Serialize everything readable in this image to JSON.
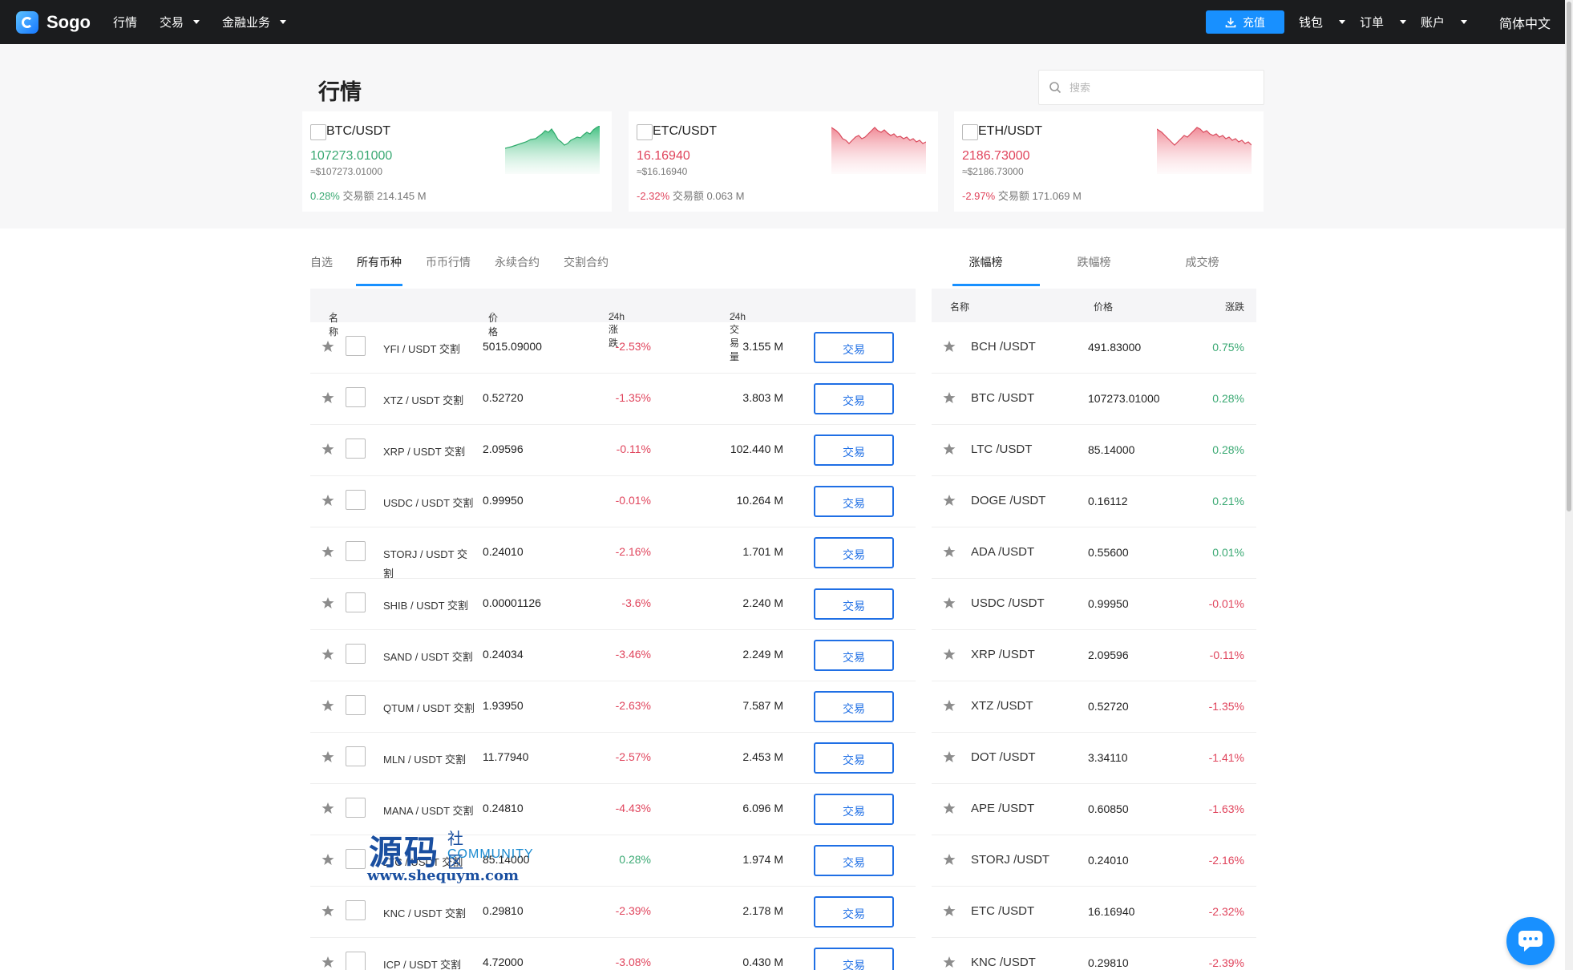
{
  "nav": {
    "logo_text": "Sogo",
    "items": [
      {
        "label": "行情",
        "caret": false
      },
      {
        "label": "交易",
        "caret": true
      },
      {
        "label": "金融业务",
        "caret": true
      }
    ],
    "recharge_label": "充值",
    "right_items": [
      {
        "label": "钱包"
      },
      {
        "label": "订单"
      },
      {
        "label": "账户"
      }
    ],
    "language": "简体中文"
  },
  "page": {
    "title": "行情",
    "search_placeholder": "搜索"
  },
  "tickers": [
    {
      "pair": "BTC/USDT",
      "price": "107273.01000",
      "usd": "≈$107273.01000",
      "change": "0.28%",
      "volume": "交易额 214.145 M",
      "trend": "up"
    },
    {
      "pair": "ETC/USDT",
      "price": "16.16940",
      "usd": "≈$16.16940",
      "change": "-2.32%",
      "volume": "交易额 0.063 M",
      "trend": "down"
    },
    {
      "pair": "ETH/USDT",
      "price": "2186.73000",
      "usd": "≈$2186.73000",
      "change": "-2.97%",
      "volume": "交易额 171.069 M",
      "trend": "down"
    }
  ],
  "tabs": [
    "自选",
    "所有币种",
    "币币行情",
    "永续合约",
    "交割合约"
  ],
  "active_tab": 1,
  "table": {
    "headers": {
      "name": "名称",
      "price": "价格",
      "change": "24h涨跌",
      "volume": "24h交易量"
    },
    "trade_label": "交易",
    "rows": [
      {
        "name": "YFI / USDT 交割",
        "price": "5015.09000",
        "change": "-2.53%",
        "volume": "3.155 M",
        "trend": "down"
      },
      {
        "name": "XTZ / USDT 交割",
        "price": "0.52720",
        "change": "-1.35%",
        "volume": "3.803 M",
        "trend": "down"
      },
      {
        "name": "XRP / USDT 交割",
        "price": "2.09596",
        "change": "-0.11%",
        "volume": "102.440 M",
        "trend": "down"
      },
      {
        "name": "USDC / USDT 交割",
        "price": "0.99950",
        "change": "-0.01%",
        "volume": "10.264 M",
        "trend": "down"
      },
      {
        "name": "STORJ / USDT 交割",
        "price": "0.24010",
        "change": "-2.16%",
        "volume": "1.701 M",
        "trend": "down"
      },
      {
        "name": "SHIB / USDT 交割",
        "price": "0.00001126",
        "change": "-3.6%",
        "volume": "2.240 M",
        "trend": "down"
      },
      {
        "name": "SAND / USDT 交割",
        "price": "0.24034",
        "change": "-3.46%",
        "volume": "2.249 M",
        "trend": "down"
      },
      {
        "name": "QTUM / USDT 交割",
        "price": "1.93950",
        "change": "-2.63%",
        "volume": "7.587 M",
        "trend": "down"
      },
      {
        "name": "MLN / USDT 交割",
        "price": "11.77940",
        "change": "-2.57%",
        "volume": "2.453 M",
        "trend": "down"
      },
      {
        "name": "MANA / USDT 交割",
        "price": "0.24810",
        "change": "-4.43%",
        "volume": "6.096 M",
        "trend": "down"
      },
      {
        "name": "LTC / USDT 交割",
        "price": "85.14000",
        "change": "0.28%",
        "volume": "1.974 M",
        "trend": "up"
      },
      {
        "name": "KNC / USDT 交割",
        "price": "0.29810",
        "change": "-2.39%",
        "volume": "2.178 M",
        "trend": "down"
      },
      {
        "name": "ICP / USDT 交割",
        "price": "4.72000",
        "change": "-3.08%",
        "volume": "0.430 M",
        "trend": "down"
      }
    ]
  },
  "rank": {
    "tabs": [
      "涨幅榜",
      "跌幅榜",
      "成交榜"
    ],
    "active_tab": 0,
    "headers": {
      "name": "名称",
      "price": "价格",
      "change": "涨跌"
    },
    "rows": [
      {
        "name": "BCH /USDT",
        "price": "491.83000",
        "change": "0.75%",
        "trend": "up"
      },
      {
        "name": "BTC /USDT",
        "price": "107273.01000",
        "change": "0.28%",
        "trend": "up"
      },
      {
        "name": "LTC /USDT",
        "price": "85.14000",
        "change": "0.28%",
        "trend": "up"
      },
      {
        "name": "DOGE /USDT",
        "price": "0.16112",
        "change": "0.21%",
        "trend": "up"
      },
      {
        "name": "ADA /USDT",
        "price": "0.55600",
        "change": "0.01%",
        "trend": "up"
      },
      {
        "name": "USDC /USDT",
        "price": "0.99950",
        "change": "-0.01%",
        "trend": "down"
      },
      {
        "name": "XRP /USDT",
        "price": "2.09596",
        "change": "-0.11%",
        "trend": "down"
      },
      {
        "name": "XTZ /USDT",
        "price": "0.52720",
        "change": "-1.35%",
        "trend": "down"
      },
      {
        "name": "DOT /USDT",
        "price": "3.34110",
        "change": "-1.41%",
        "trend": "down"
      },
      {
        "name": "APE /USDT",
        "price": "0.60850",
        "change": "-1.63%",
        "trend": "down"
      },
      {
        "name": "STORJ /USDT",
        "price": "0.24010",
        "change": "-2.16%",
        "trend": "down"
      },
      {
        "name": "ETC /USDT",
        "price": "16.16940",
        "change": "-2.32%",
        "trend": "down"
      },
      {
        "name": "KNC /USDT",
        "price": "0.29810",
        "change": "-2.39%",
        "trend": "down"
      }
    ]
  },
  "watermark": {
    "big": "源码",
    "small": "社区",
    "community": "COMMUNITY",
    "url": "www.shequym.com"
  },
  "colors": {
    "up": "#3aa973",
    "down": "#e0445c",
    "accent": "#1890ff"
  },
  "icons": [
    "logo-icon",
    "download-icon",
    "search-icon",
    "star-icon",
    "chat-icon"
  ]
}
